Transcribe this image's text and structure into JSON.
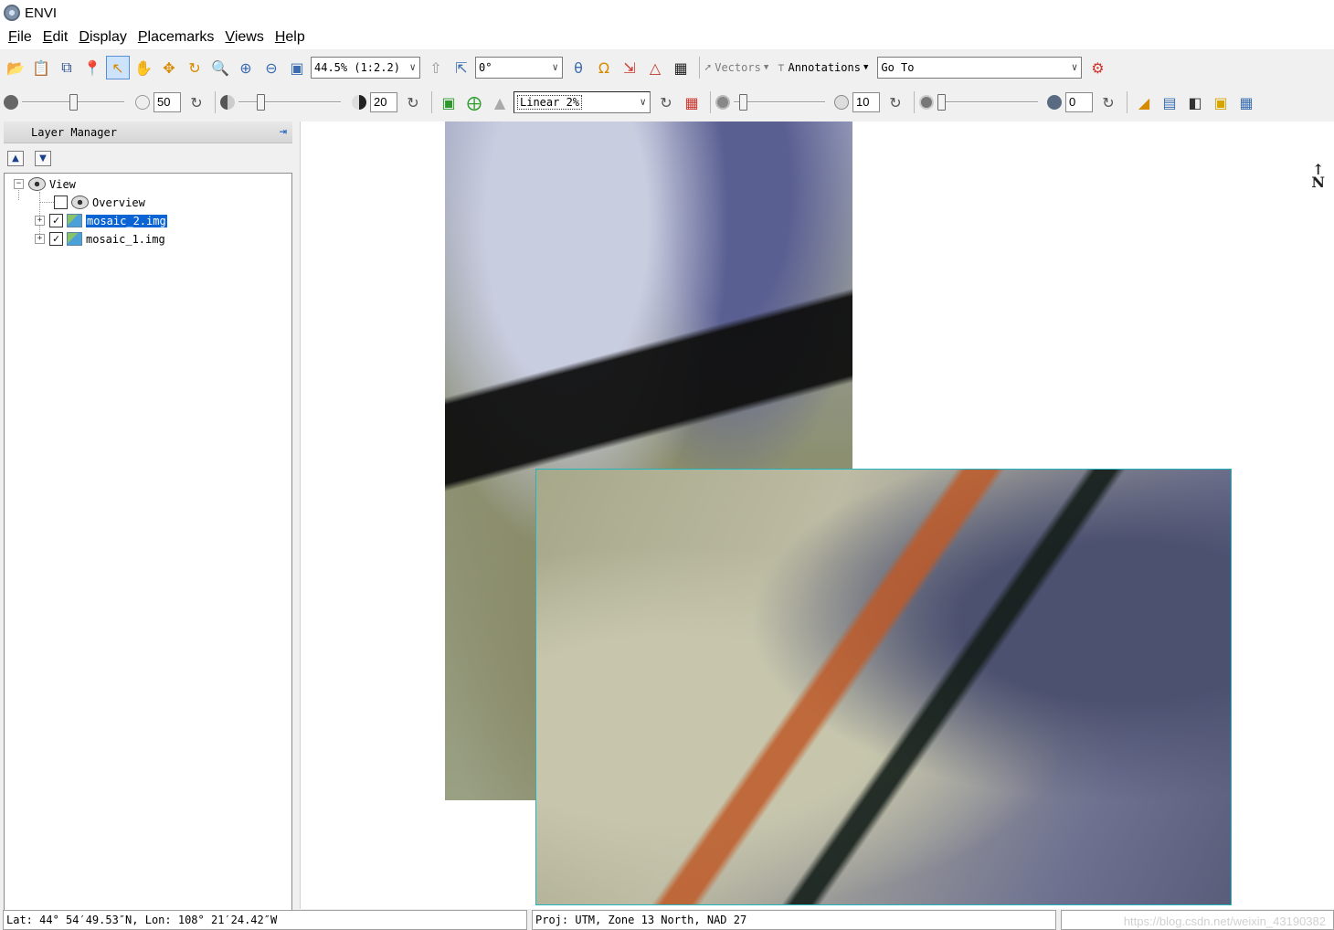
{
  "window": {
    "title": "ENVI"
  },
  "menu": [
    "File",
    "Edit",
    "Display",
    "Placemarks",
    "Views",
    "Help"
  ],
  "toolbar1": {
    "zoom_value": "44.5% (1:2.2)",
    "rotation_value": "0°",
    "vectors_label": "Vectors",
    "annotations_label": "Annotations",
    "goto_value": "Go To"
  },
  "toolbar2": {
    "brightness_value": "50",
    "contrast_value": "20",
    "stretch_value": "Linear 2%",
    "sharpen_value": "10",
    "transparency_value": "0"
  },
  "layer_manager": {
    "title": "Layer Manager",
    "root": "View",
    "items": [
      {
        "label": "Overview",
        "checked": false,
        "selected": false
      },
      {
        "label": "mosaic_2.img",
        "checked": true,
        "selected": true
      },
      {
        "label": "mosaic_1.img",
        "checked": true,
        "selected": false
      }
    ]
  },
  "view": {
    "north_label": "N"
  },
  "status": {
    "coords": "Lat: 44° 54′49.53″N, Lon: 108° 21′24.42″W",
    "projection": "Proj: UTM, Zone 13 North, NAD 27",
    "watermark": "https://blog.csdn.net/weixin_43190382"
  }
}
